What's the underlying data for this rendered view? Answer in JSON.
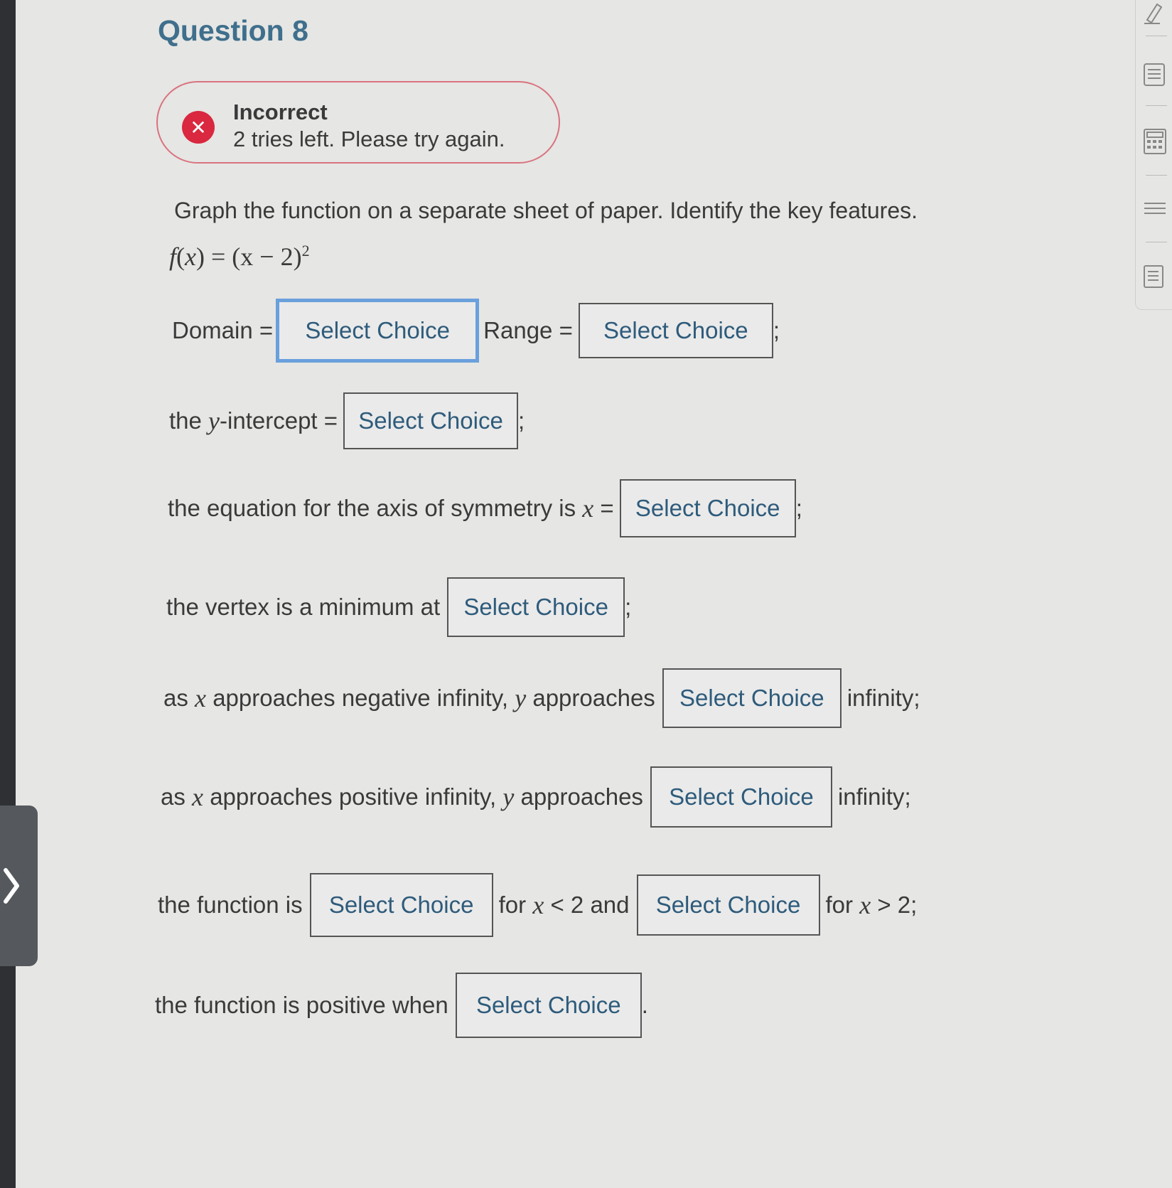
{
  "question_title": "Question 8",
  "feedback": {
    "icon": "close-icon",
    "status": "Incorrect",
    "message": "2 tries left. Please try again."
  },
  "prompt": "Graph the function on a separate sheet of paper. Identify the key features.",
  "formula": {
    "lhs": "f",
    "var": "x",
    "rhs": "= (x − 2)",
    "exponent": "2"
  },
  "fields": {
    "domain": {
      "label": "Domain =",
      "value": "Select Choice"
    },
    "range": {
      "label": "Range =",
      "value": "Select Choice",
      "suffix": ";"
    },
    "y_intercept": {
      "pre": "the",
      "var": "y",
      "label": "-intercept =",
      "value": "Select Choice",
      "suffix": ";"
    },
    "axis": {
      "label": "the equation for the axis of symmetry is",
      "var": "x",
      "eq": "=",
      "value": "Select Choice",
      "suffix": ";"
    },
    "vertex": {
      "label": "the vertex is a minimum at",
      "value": "Select Choice",
      "suffix": ";"
    },
    "neg_inf": {
      "pre": "as",
      "var_x": "x",
      "mid": "approaches negative infinity,",
      "var_y": "y",
      "post": "approaches",
      "value": "Select Choice",
      "suffix": "infinity;"
    },
    "pos_inf": {
      "pre": "as",
      "var_x": "x",
      "mid": "approaches positive infinity,",
      "var_y": "y",
      "post": "approaches",
      "value": "Select Choice",
      "suffix": "infinity;"
    },
    "monotonic": {
      "label": "the function is",
      "value1": "Select Choice",
      "mid_pre": "for",
      "mid_var": "x",
      "mid_cond": "< 2",
      "mid_and": "and",
      "value2": "Select Choice",
      "end_pre": "for",
      "end_var": "x",
      "end_cond": "> 2;"
    },
    "positive": {
      "label": "the function is positive when",
      "value": "Select Choice",
      "suffix": "."
    }
  },
  "sidebar_icons": [
    "pencil-icon",
    "notes-icon",
    "calculator-icon",
    "list-icon",
    "reference-icon"
  ],
  "colors": {
    "title": "#3f6f8c",
    "error": "#d9283f",
    "choice_text": "#2e5b7b",
    "focus_border": "#6aa0dc"
  }
}
